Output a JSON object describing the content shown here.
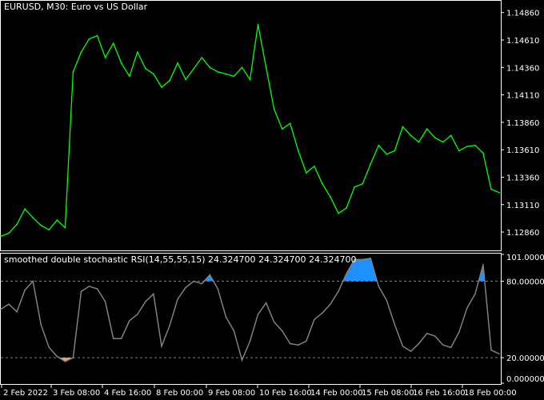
{
  "header": {
    "symbol_title": "EURUSD, M30:  Euro vs US Dollar"
  },
  "indicator": {
    "title": "smoothed double stochastic RSI(14,55,55,15) 24.324700 24.324700 24.324700"
  },
  "price_axis": {
    "ticks": [
      "1.14860",
      "1.14610",
      "1.14360",
      "1.14110",
      "1.13860",
      "1.13610",
      "1.13360",
      "1.13110",
      "1.12860"
    ]
  },
  "oscillator_axis": {
    "ticks": [
      "101.000000",
      "80.000000",
      "20.000000",
      "0.000000"
    ],
    "upper_level": 80,
    "lower_level": 20,
    "range": [
      0,
      101
    ]
  },
  "time_axis": {
    "ticks": [
      "2 Feb 2022",
      "3 Feb 08:00",
      "4 Feb 16:00",
      "8 Feb 00:00",
      "9 Feb 08:00",
      "10 Feb 16:00",
      "14 Feb 00:00",
      "15 Feb 08:00",
      "16 Feb 16:00",
      "18 Feb 00:00"
    ]
  },
  "colors": {
    "background": "#000000",
    "price_line": "#00ff00",
    "oscillator_line": "#808080",
    "overbought_fill": "#1e90ff",
    "oversold_fill": "#f4a460",
    "level_line": "#808080",
    "axis": "#ffffff"
  },
  "chart_data": [
    {
      "type": "line",
      "series": [
        {
          "name": "EURUSD",
          "x": [
            0,
            10,
            20,
            30,
            40,
            50,
            60,
            70,
            80,
            90,
            100,
            110,
            120,
            130,
            140,
            150,
            160,
            170,
            180,
            190,
            200,
            210,
            220,
            230,
            240,
            250,
            260,
            270,
            280,
            290,
            300,
            310,
            320,
            330,
            340,
            350,
            360,
            370,
            380,
            390,
            400,
            410,
            420,
            430,
            440,
            450,
            460,
            470,
            480,
            490,
            500,
            510,
            520,
            530,
            540,
            550,
            560,
            570,
            580,
            590,
            600,
            610,
            620
          ],
          "values": [
            1.1282,
            1.1285,
            1.1293,
            1.1307,
            1.1299,
            1.1292,
            1.1288,
            1.1297,
            1.129,
            1.1432,
            1.145,
            1.1462,
            1.1465,
            1.1445,
            1.1458,
            1.144,
            1.1428,
            1.145,
            1.1435,
            1.143,
            1.1418,
            1.1424,
            1.144,
            1.1425,
            1.1435,
            1.1445,
            1.1436,
            1.1432,
            1.143,
            1.1428,
            1.1436,
            1.1425,
            1.1475,
            1.1436,
            1.1398,
            1.138,
            1.1385,
            1.136,
            1.134,
            1.1346,
            1.133,
            1.1318,
            1.1303,
            1.1308,
            1.1327,
            1.133,
            1.1348,
            1.1365,
            1.1357,
            1.136,
            1.1382,
            1.1374,
            1.1368,
            1.138,
            1.1372,
            1.1368,
            1.1374,
            1.136,
            1.1364,
            1.1365,
            1.1358,
            1.1325,
            1.1322
          ]
        }
      ],
      "ylim": [
        1.127,
        1.1496
      ]
    },
    {
      "type": "area",
      "series": [
        {
          "name": "smoothed double stochastic RSI",
          "x": [
            0,
            10,
            20,
            30,
            40,
            50,
            60,
            70,
            80,
            90,
            100,
            110,
            120,
            130,
            140,
            150,
            160,
            170,
            180,
            190,
            200,
            210,
            220,
            230,
            240,
            250,
            260,
            270,
            280,
            290,
            300,
            310,
            320,
            330,
            340,
            350,
            360,
            370,
            380,
            390,
            400,
            410,
            420,
            430,
            440,
            450,
            460,
            470,
            480,
            490,
            500,
            510,
            520,
            530,
            540,
            550,
            560,
            570,
            580,
            590,
            600,
            610,
            620
          ],
          "values": [
            58,
            62,
            56,
            73,
            80,
            46,
            28,
            21,
            17,
            20,
            72,
            76,
            74,
            64,
            35,
            35,
            49,
            54,
            64,
            70,
            29,
            45,
            66,
            75,
            80,
            78,
            85,
            74,
            52,
            41,
            18,
            33,
            54,
            63,
            48,
            41,
            31,
            30,
            33,
            50,
            55,
            62,
            72,
            86,
            97,
            97,
            98,
            76,
            65,
            46,
            29,
            25,
            31,
            39,
            37,
            30,
            28,
            40,
            59,
            70,
            93,
            26,
            23
          ]
        }
      ],
      "ylim": [
        0,
        101
      ],
      "levels": [
        80,
        20
      ]
    }
  ]
}
